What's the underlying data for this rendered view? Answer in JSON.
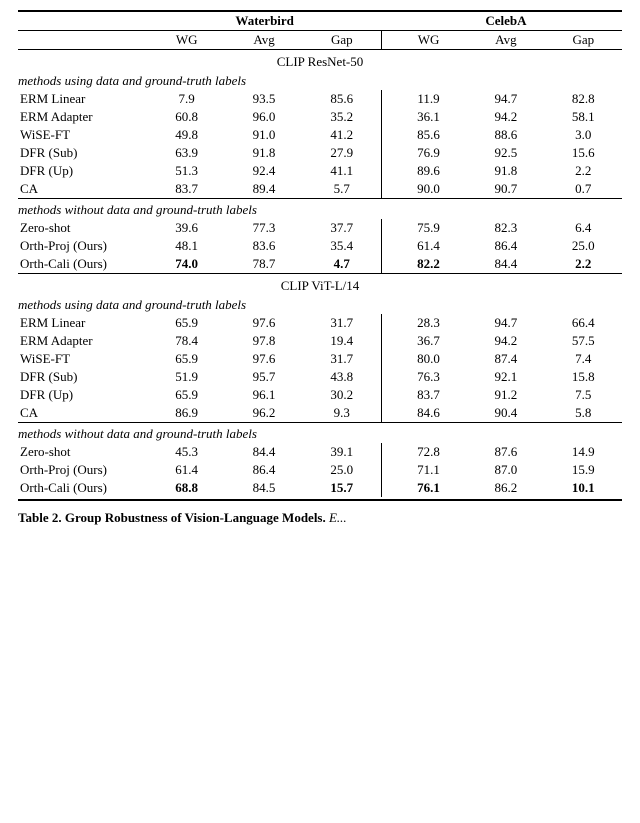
{
  "table": {
    "headers": {
      "waterbird": "Waterbird",
      "celeba": "CelebA",
      "cols": [
        "WG",
        "Avg",
        "Gap",
        "WG",
        "Avg",
        "Gap"
      ]
    },
    "sections": [
      {
        "section_title": "CLIP ResNet-50",
        "group1_label": "methods using data and ground-truth labels",
        "group1_rows": [
          {
            "label": "ERM Linear",
            "wg": "7.9",
            "avg": "93.5",
            "gap": "85.6",
            "c_wg": "11.9",
            "c_avg": "94.7",
            "c_gap": "82.8",
            "bold": []
          },
          {
            "label": "ERM Adapter",
            "wg": "60.8",
            "avg": "96.0",
            "gap": "35.2",
            "c_wg": "36.1",
            "c_avg": "94.2",
            "c_gap": "58.1",
            "bold": []
          },
          {
            "label": "WiSE-FT",
            "wg": "49.8",
            "avg": "91.0",
            "gap": "41.2",
            "c_wg": "85.6",
            "c_avg": "88.6",
            "c_gap": "3.0",
            "bold": []
          },
          {
            "label": "DFR (Sub)",
            "wg": "63.9",
            "avg": "91.8",
            "gap": "27.9",
            "c_wg": "76.9",
            "c_avg": "92.5",
            "c_gap": "15.6",
            "bold": []
          },
          {
            "label": "DFR (Up)",
            "wg": "51.3",
            "avg": "92.4",
            "gap": "41.1",
            "c_wg": "89.6",
            "c_avg": "91.8",
            "c_gap": "2.2",
            "bold": []
          },
          {
            "label": "CA",
            "wg": "83.7",
            "avg": "89.4",
            "gap": "5.7",
            "c_wg": "90.0",
            "c_avg": "90.7",
            "c_gap": "0.7",
            "bold": []
          }
        ],
        "group2_label": "methods without data and ground-truth labels",
        "group2_rows": [
          {
            "label": "Zero-shot",
            "wg": "39.6",
            "avg": "77.3",
            "gap": "37.7",
            "c_wg": "75.9",
            "c_avg": "82.3",
            "c_gap": "6.4",
            "bold": []
          },
          {
            "label": "Orth-Proj (Ours)",
            "wg": "48.1",
            "avg": "83.6",
            "gap": "35.4",
            "c_wg": "61.4",
            "c_avg": "86.4",
            "c_gap": "25.0",
            "bold": []
          },
          {
            "label": "Orth-Cali (Ours)",
            "wg": "74.0",
            "avg": "78.7",
            "gap": "4.7",
            "c_wg": "82.2",
            "c_avg": "84.4",
            "c_gap": "2.2",
            "bold": [
              "wg",
              "gap",
              "c_wg",
              "c_gap"
            ]
          }
        ]
      },
      {
        "section_title": "CLIP ViT-L/14",
        "group1_label": "methods using data and ground-truth labels",
        "group1_rows": [
          {
            "label": "ERM Linear",
            "wg": "65.9",
            "avg": "97.6",
            "gap": "31.7",
            "c_wg": "28.3",
            "c_avg": "94.7",
            "c_gap": "66.4",
            "bold": []
          },
          {
            "label": "ERM Adapter",
            "wg": "78.4",
            "avg": "97.8",
            "gap": "19.4",
            "c_wg": "36.7",
            "c_avg": "94.2",
            "c_gap": "57.5",
            "bold": []
          },
          {
            "label": "WiSE-FT",
            "wg": "65.9",
            "avg": "97.6",
            "gap": "31.7",
            "c_wg": "80.0",
            "c_avg": "87.4",
            "c_gap": "7.4",
            "bold": []
          },
          {
            "label": "DFR (Sub)",
            "wg": "51.9",
            "avg": "95.7",
            "gap": "43.8",
            "c_wg": "76.3",
            "c_avg": "92.1",
            "c_gap": "15.8",
            "bold": []
          },
          {
            "label": "DFR (Up)",
            "wg": "65.9",
            "avg": "96.1",
            "gap": "30.2",
            "c_wg": "83.7",
            "c_avg": "91.2",
            "c_gap": "7.5",
            "bold": []
          },
          {
            "label": "CA",
            "wg": "86.9",
            "avg": "96.2",
            "gap": "9.3",
            "c_wg": "84.6",
            "c_avg": "90.4",
            "c_gap": "5.8",
            "bold": []
          }
        ],
        "group2_label": "methods without data and ground-truth labels",
        "group2_rows": [
          {
            "label": "Zero-shot",
            "wg": "45.3",
            "avg": "84.4",
            "gap": "39.1",
            "c_wg": "72.8",
            "c_avg": "87.6",
            "c_gap": "14.9",
            "bold": []
          },
          {
            "label": "Orth-Proj (Ours)",
            "wg": "61.4",
            "avg": "86.4",
            "gap": "25.0",
            "c_wg": "71.1",
            "c_avg": "87.0",
            "c_gap": "15.9",
            "bold": []
          },
          {
            "label": "Orth-Cali (Ours)",
            "wg": "68.8",
            "avg": "84.5",
            "gap": "15.7",
            "c_wg": "76.1",
            "c_avg": "86.2",
            "c_gap": "10.1",
            "bold": [
              "wg",
              "gap",
              "c_wg",
              "c_gap"
            ]
          }
        ]
      }
    ],
    "caption": "Table 2. Group Robustness of Vision-Language Models. E..."
  }
}
